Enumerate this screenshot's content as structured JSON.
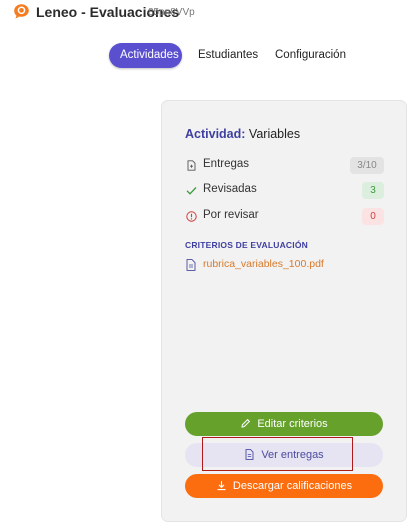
{
  "app": {
    "title": "Leneo - Evaluaciones",
    "code": "85pn8VVp"
  },
  "tabs": [
    {
      "label": "Actividades",
      "active": true
    },
    {
      "label": "Estudiantes",
      "active": false
    },
    {
      "label": "Configuración",
      "active": false
    }
  ],
  "activity": {
    "label": "Actividad:",
    "name": "Variables"
  },
  "stats": [
    {
      "label": "Entregas",
      "value": "3/10",
      "icon": "file-icon"
    },
    {
      "label": "Revisadas",
      "value": "3",
      "icon": "check-icon"
    },
    {
      "label": "Por revisar",
      "value": "0",
      "icon": "alert-icon"
    }
  ],
  "criteria": {
    "title": "CRITERIOS DE EVALUACIÓN",
    "file": "rubrica_variables_100.pdf"
  },
  "buttons": {
    "edit": "Editar criterios",
    "view": "Ver entregas",
    "download": "Descargar calificaciones"
  },
  "colors": {
    "accent": "#5a4fcf",
    "edit": "#66a12c",
    "download": "#fb6d0f",
    "file_link": "#d7792a"
  }
}
